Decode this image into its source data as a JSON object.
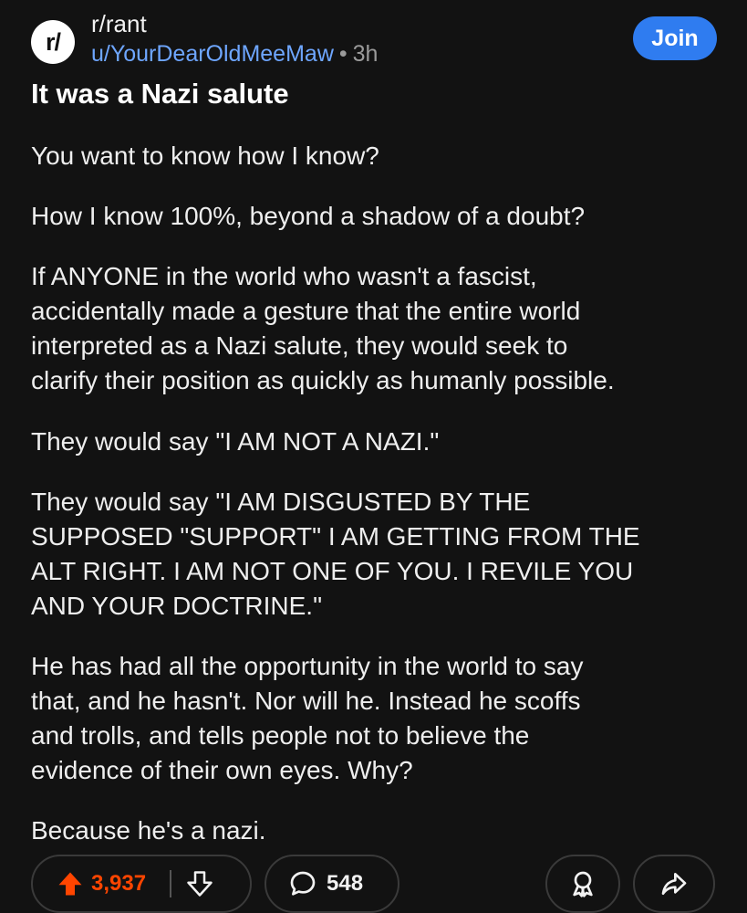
{
  "header": {
    "avatar_text": "r/",
    "subreddit": "r/rant",
    "username": "u/YourDearOldMeeMaw",
    "separator": "•",
    "time_ago": "3h",
    "join_label": "Join"
  },
  "post": {
    "title": "It was a Nazi salute",
    "paragraphs": [
      "You want to know how I know?",
      "How I know 100%, beyond a shadow of a doubt?",
      "If ANYONE in the world who wasn't a fascist,\naccidentally made a gesture that the entire world\ninterpreted as a Nazi salute, they would seek to\nclarify their position as quickly as humanly possible.",
      "They would say \"I AM NOT A NAZI.\"",
      "They would say \"I AM DISGUSTED BY THE\nSUPPOSED \"SUPPORT\" I AM GETTING FROM THE\nALT RIGHT. I AM NOT ONE OF YOU. I REVILE YOU\nAND YOUR DOCTRINE.\"",
      "He has had all the opportunity in the world to say\nthat, and he hasn't. Nor will he. Instead he scoffs\nand trolls, and tells people not to believe the\nevidence of their own eyes. Why?",
      "Because he's a nazi."
    ]
  },
  "actions": {
    "upvotes": "3,937",
    "comments": "548",
    "icons": {
      "upvote": "arrow-up-icon",
      "downvote": "arrow-down-icon",
      "comment": "comment-bubble-icon",
      "award": "award-icon",
      "share": "share-arrow-icon"
    }
  },
  "colors": {
    "background": "#121212",
    "join_button": "#2f7cf0",
    "username_link": "#6ea6ff",
    "upvote_active": "#ff4500"
  }
}
